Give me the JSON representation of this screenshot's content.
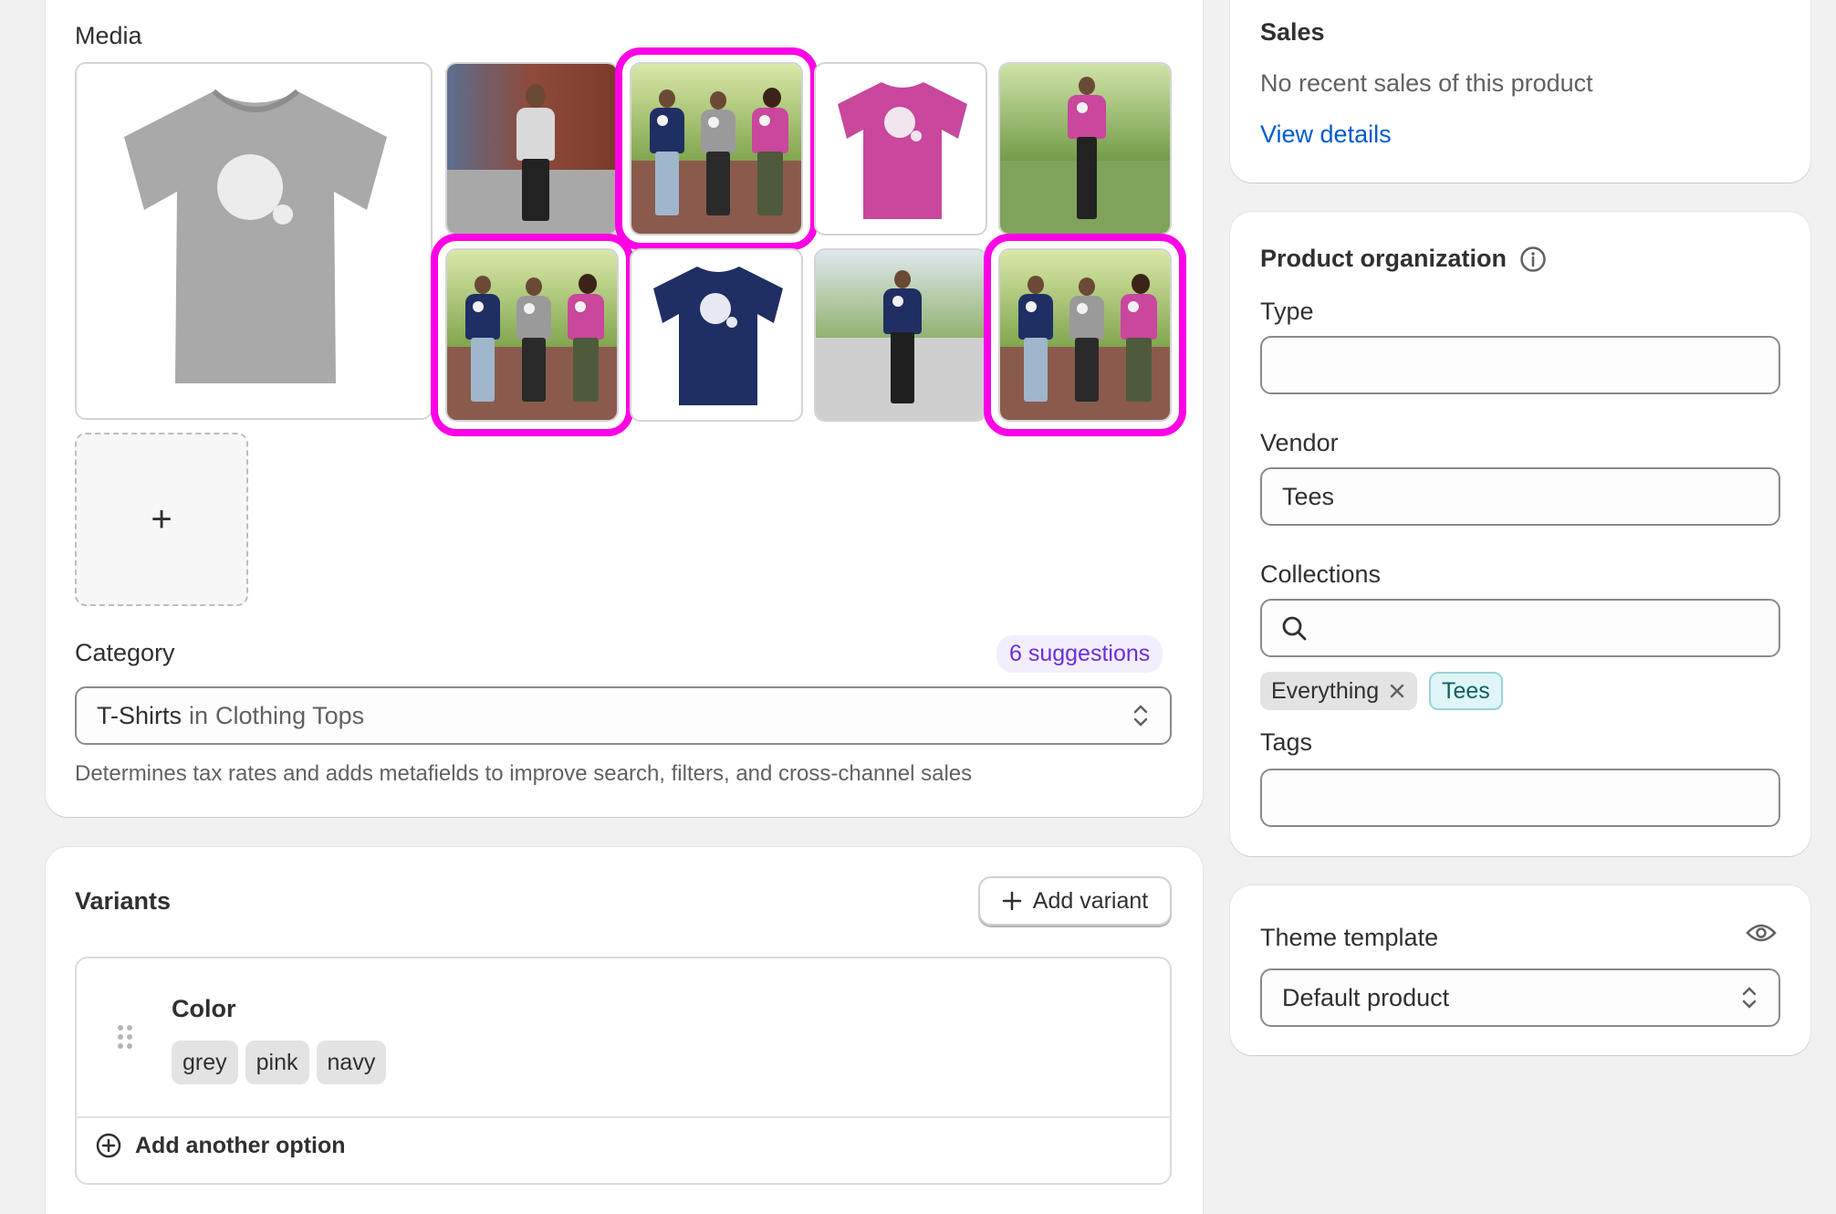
{
  "media": {
    "title": "Media",
    "add_symbol": "+"
  },
  "category": {
    "label": "Category",
    "suggestions": "6 suggestions",
    "value_main": "T-Shirts",
    "value_in": "in",
    "value_parent": "Clothing Tops",
    "help": "Determines tax rates and adds metafields to improve search, filters, and cross-channel sales"
  },
  "variants": {
    "title": "Variants",
    "add_variant": "Add variant",
    "option_name": "Color",
    "option_values": [
      "grey",
      "pink",
      "navy"
    ],
    "add_another": "Add another option"
  },
  "sales": {
    "title": "Sales",
    "text": "No recent sales of this product",
    "link": "View details"
  },
  "organization": {
    "title": "Product organization",
    "type_label": "Type",
    "type_value": "",
    "vendor_label": "Vendor",
    "vendor_value": "Tees",
    "collections_label": "Collections",
    "collections_tags": [
      "Everything",
      "Tees"
    ],
    "tags_label": "Tags",
    "tags_value": ""
  },
  "theme": {
    "title": "Theme template",
    "value": "Default product"
  },
  "colors": {
    "selection": "#ff00e6",
    "link": "#005bd3",
    "suggest_text": "#6a2fd8",
    "tees_tag_bg": "#e0f5f5",
    "tee_grey": "#a9a9a9",
    "tee_pink": "#c9479d",
    "tee_navy": "#1f2f63"
  }
}
